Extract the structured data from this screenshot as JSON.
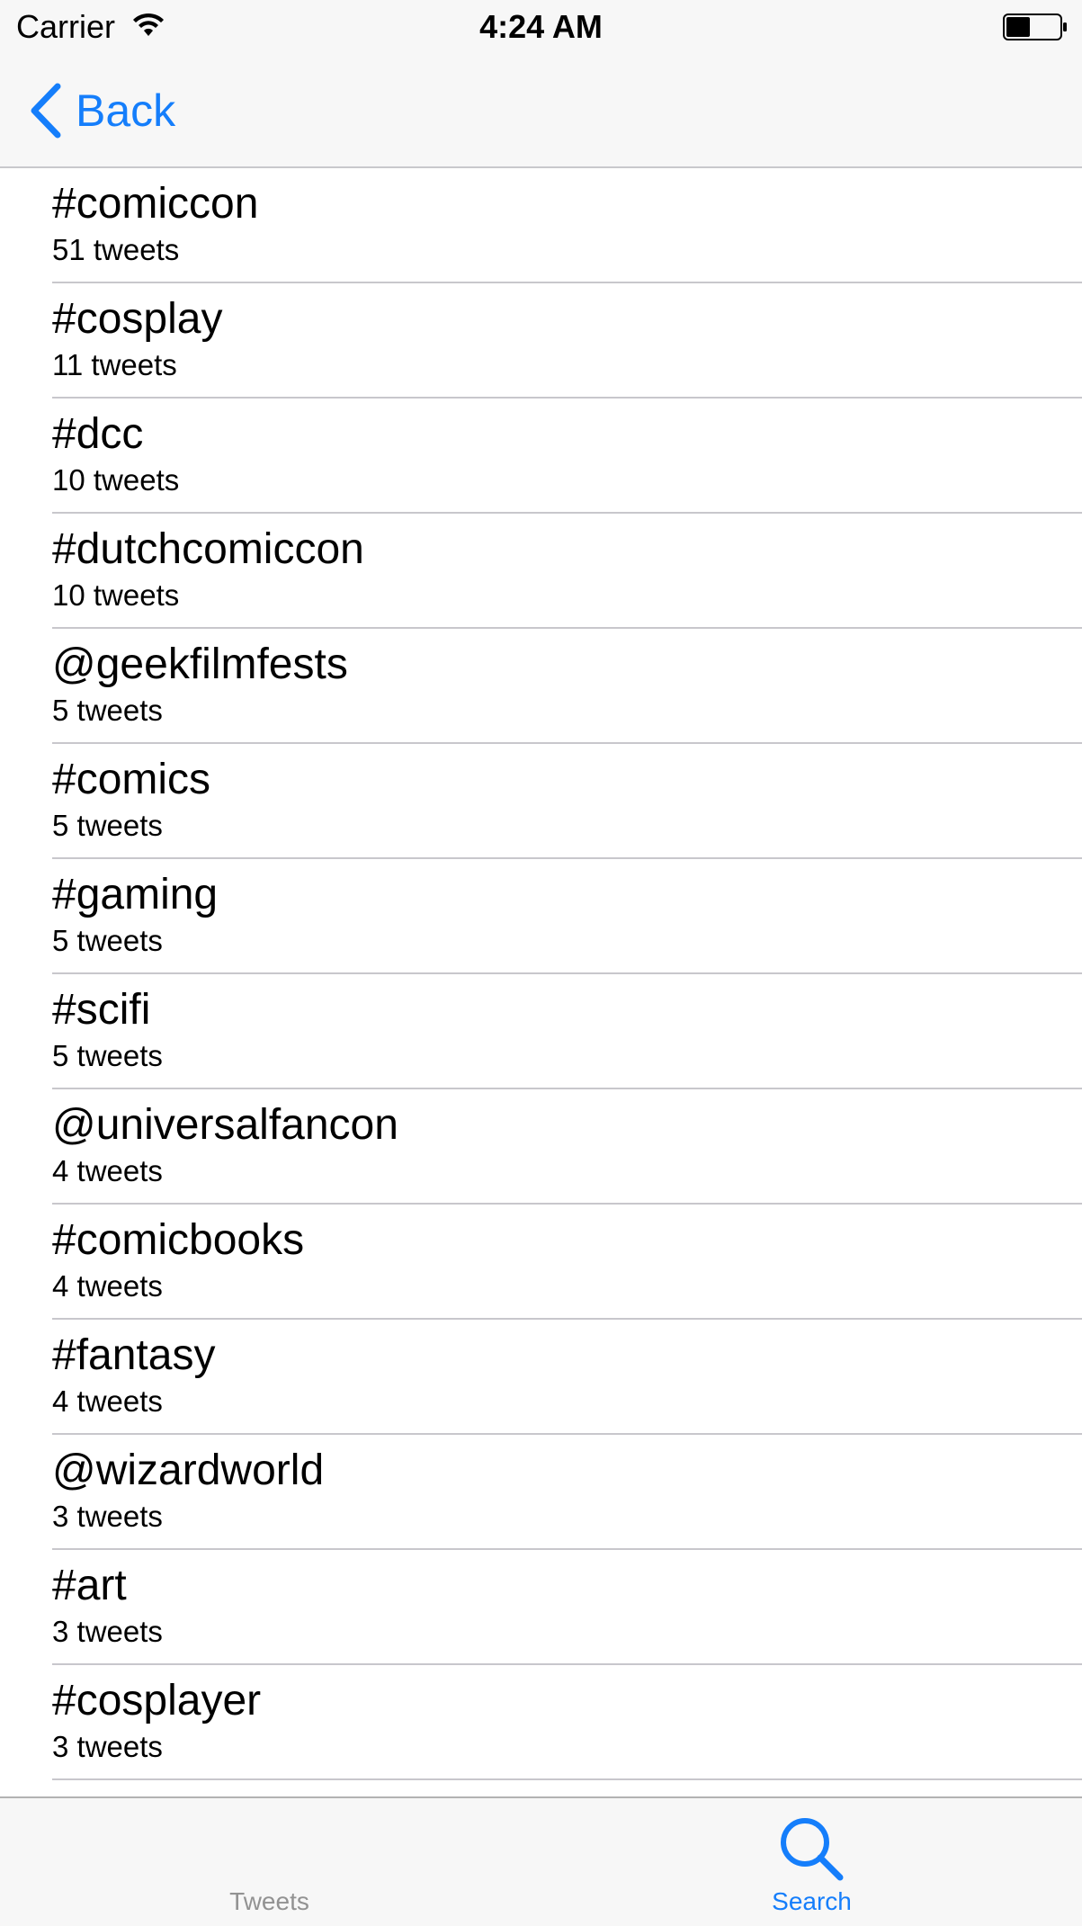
{
  "status_bar": {
    "carrier": "Carrier",
    "time": "4:24 AM",
    "battery_level": 0.45
  },
  "nav": {
    "back_label": "Back"
  },
  "list": {
    "items": [
      {
        "title": "#comiccon",
        "subtitle": "51 tweets"
      },
      {
        "title": "#cosplay",
        "subtitle": "11 tweets"
      },
      {
        "title": "#dcc",
        "subtitle": "10 tweets"
      },
      {
        "title": "#dutchcomiccon",
        "subtitle": "10 tweets"
      },
      {
        "title": "@geekfilmfests",
        "subtitle": "5 tweets"
      },
      {
        "title": "#comics",
        "subtitle": "5 tweets"
      },
      {
        "title": "#gaming",
        "subtitle": "5 tweets"
      },
      {
        "title": "#scifi",
        "subtitle": "5 tweets"
      },
      {
        "title": "@universalfancon",
        "subtitle": "4 tweets"
      },
      {
        "title": "#comicbooks",
        "subtitle": "4 tweets"
      },
      {
        "title": "#fantasy",
        "subtitle": "4 tweets"
      },
      {
        "title": "@wizardworld",
        "subtitle": "3 tweets"
      },
      {
        "title": "#art",
        "subtitle": "3 tweets"
      },
      {
        "title": "#cosplayer",
        "subtitle": "3 tweets"
      }
    ]
  },
  "tab_bar": {
    "tabs": [
      {
        "label": "Tweets",
        "icon": "tweets-icon",
        "selected": false
      },
      {
        "label": "Search",
        "icon": "search-icon",
        "selected": true
      }
    ]
  },
  "colors": {
    "accent": "#157efb",
    "inactive_tab": "#929292",
    "separator": "#c8c7cc",
    "bar_background": "#f7f7f7"
  }
}
